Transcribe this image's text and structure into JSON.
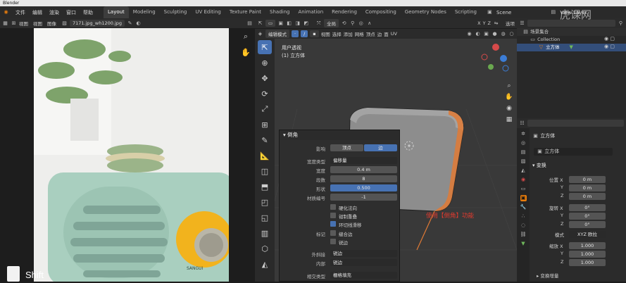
{
  "window": {
    "title": "Blender"
  },
  "menu": [
    "文件",
    "编辑",
    "渲染",
    "窗口",
    "帮助"
  ],
  "workspaces": [
    "Layout",
    "Modeling",
    "Sculpting",
    "UV Editing",
    "Texture Paint",
    "Shading",
    "Animation",
    "Rendering",
    "Compositing",
    "Geometry Nodes",
    "Scripting"
  ],
  "active_workspace": "Layout",
  "scene_name": "Scene",
  "view_layer": "View Layer",
  "image_editor": {
    "menu": [
      "视图",
      "视图",
      "图像"
    ],
    "image_name": "7171.jpg_wh1200.jpg",
    "radio_brand": "SANGUI"
  },
  "viewport": {
    "mode": "编辑模式",
    "menus": [
      "视图",
      "选择",
      "添加",
      "网格",
      "顶点",
      "边",
      "面",
      "UV"
    ],
    "transform_orientation": "全局",
    "overlay_label": "选项",
    "info_line1": "用户透视",
    "info_line2": "(1) 立方体",
    "annotation": "使用【倒角】功能",
    "axes": [
      "X",
      "Y",
      "Z"
    ]
  },
  "bevel_panel": {
    "title": "倒角",
    "affect_label": "影响",
    "affect_options": [
      "顶点",
      "边"
    ],
    "affect_selected": "边",
    "width_type_label": "宽度类型",
    "width_type": "偏移量",
    "width_label": "宽度",
    "width": "0.4 m",
    "segments_label": "段数",
    "segments": "8",
    "shape_label": "形状",
    "shape": "0.500",
    "material_label": "材质编号",
    "material": "-1",
    "harden_normals": "硬化法向",
    "clamp_overlap": "钳制重叠",
    "loop_slide": "环切线滑移",
    "mark_label": "标记",
    "mark_seams": "缝合边",
    "mark_sharp": "锐边",
    "miter_outer_label": "外斜接",
    "miter_outer": "锐边",
    "miter_inner_label": "内部",
    "miter_inner": "锐边",
    "intersection_label": "相交类型",
    "intersection": "栅格填充"
  },
  "outliner": {
    "root": "场景集合",
    "collection": "Collection",
    "object": "立方体"
  },
  "properties": {
    "object_name": "立方体",
    "object_field": "立方体",
    "section_transform": "变换",
    "location_label": "位置 X",
    "location": [
      "0 m",
      "0 m",
      "0 m"
    ],
    "rotation_label": "旋转 X",
    "rotation": [
      "0°",
      "0°",
      "0°"
    ],
    "mode_label": "模式",
    "mode_value": "XYZ 欧拉",
    "scale_label": "缩放 X",
    "scale": [
      "1.000",
      "1.000",
      "1.000"
    ],
    "section_delta": "变换增量",
    "axis_y": "Y",
    "axis_z": "Z"
  },
  "overlay": {
    "shift_key": "Shift",
    "watermark": "虎课网"
  },
  "colors": {
    "accent": "#4772b3",
    "annotation": "#e23a2e",
    "edge_highlight": "#e07a35"
  }
}
